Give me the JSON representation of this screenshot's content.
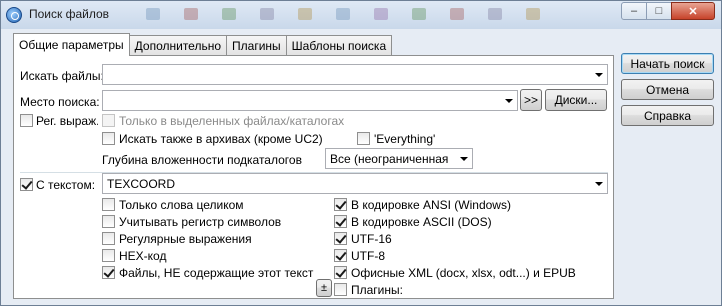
{
  "window": {
    "title": "Поиск файлов",
    "buttons": {
      "minimize": "–",
      "maximize": "□",
      "close": "✕"
    }
  },
  "tabs": [
    {
      "label": "Общие параметры"
    },
    {
      "label": "Дополнительно"
    },
    {
      "label": "Плагины"
    },
    {
      "label": "Шаблоны поиска"
    }
  ],
  "form": {
    "search_for_label": "Искать файлы:",
    "search_for_value": "",
    "search_in_label": "Место поиска:",
    "search_in_value": "",
    "browse_button": ">>",
    "drives_button": "Диски...",
    "regex_label": "Рег. выраж.",
    "only_selected_label": "Только в выделенных файлах/каталогах",
    "search_archives_label": "Искать также в архивах (кроме UC2)",
    "everything_label": "'Everything'",
    "depth_label": "Глубина вложенности подкаталогов",
    "depth_value": "Все (неограниченная",
    "with_text_label": "С текстом:",
    "text_value": "TEXCOORD",
    "plus_minus_button": "±"
  },
  "options_left": [
    {
      "label": "Только слова целиком",
      "checked": false
    },
    {
      "label": "Учитывать регистр символов",
      "checked": false
    },
    {
      "label": "Регулярные выражения",
      "checked": false
    },
    {
      "label": "HEX-код",
      "checked": false
    },
    {
      "label": "Файлы, НЕ содержащие этот текст",
      "checked": true
    }
  ],
  "options_right": [
    {
      "label": "В кодировке ANSI (Windows)",
      "checked": true
    },
    {
      "label": "В кодировке ASCII (DOS)",
      "checked": true
    },
    {
      "label": "UTF-16",
      "checked": true
    },
    {
      "label": "UTF-8",
      "checked": true
    },
    {
      "label": "Офисные XML (docx, xlsx, odt...) и EPUB",
      "checked": true
    },
    {
      "label": "Плагины:",
      "checked": false
    }
  ],
  "side_buttons": {
    "start": "Начать поиск",
    "cancel": "Отмена",
    "help": "Справка"
  }
}
